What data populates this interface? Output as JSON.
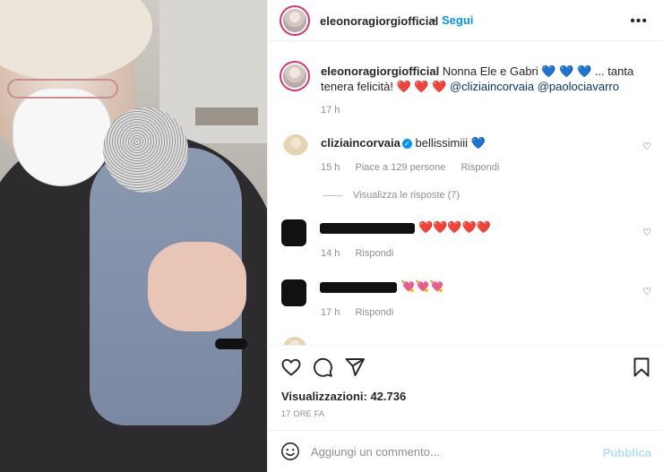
{
  "post": {
    "author": "eleonoragiorgiofficial",
    "separator": "•",
    "follow_label": "Segui",
    "more_icon": "more-options-icon"
  },
  "caption": {
    "username": "eleonoragiorgiofficial",
    "text_part1": "Nonna Ele e Gabri",
    "blue_hearts": "💙 💙 💙",
    "text_part2": "... tanta tenera felicità!",
    "red_hearts": "❤️ ❤️ ❤️",
    "mention1": "@cliziaincorvaia",
    "mention2": "@paolociavarro",
    "time": "17 h"
  },
  "comments": [
    {
      "username": "cliziaincorvaia",
      "verified": true,
      "text": "bellissimiii",
      "emoji": "💙",
      "time": "15 h",
      "likes": "Piace a 129 persone",
      "reply_label": "Rispondi",
      "view_replies": "Visualizza le risposte (7)"
    },
    {
      "username_redacted": true,
      "text": "",
      "emoji": "❤️❤️❤️❤️❤️",
      "time": "14 h",
      "reply_label": "Rispondi"
    },
    {
      "username_redacted": true,
      "text": "",
      "emoji": "💘💘💘",
      "time": "17 h",
      "reply_label": "Rispondi"
    }
  ],
  "actions": {
    "views": "Visualizzazioni: 42.736",
    "posted": "17 ORE FA"
  },
  "add_comment": {
    "placeholder": "Aggiungi un commento...",
    "publish_label": "Pubblica"
  }
}
